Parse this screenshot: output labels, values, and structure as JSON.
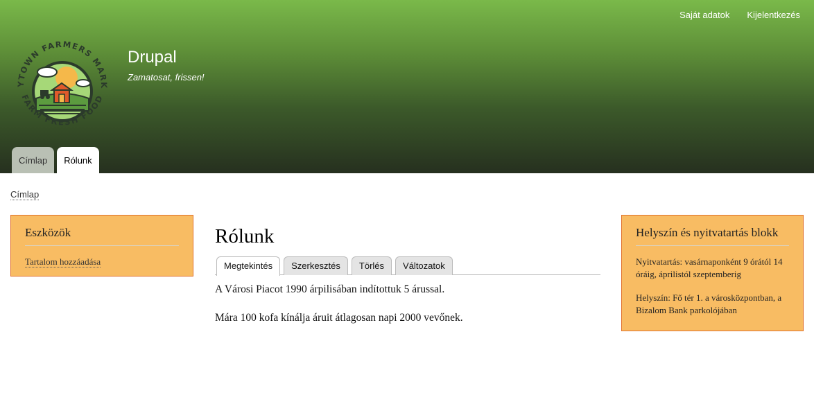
{
  "secondary_menu": {
    "items": [
      "Saját adatok",
      "Kijelentkezés"
    ]
  },
  "logo": {
    "top_text": "ANYTOWN FARMERS MARKET",
    "bottom_text": "FARM FRESH FOOD",
    "colors": {
      "ring": "#2b3a2b",
      "badge": "#8fc964",
      "sun": "#f5b84a",
      "barn": "#e05a2b",
      "field": "#5c9b3f"
    }
  },
  "site": {
    "name": "Drupal",
    "slogan": "Zamatosat, frissen!"
  },
  "primary_tabs": [
    {
      "label": "Címlap",
      "active": false
    },
    {
      "label": "Rólunk",
      "active": true
    }
  ],
  "breadcrumb": {
    "items": [
      "Címlap"
    ]
  },
  "left_block": {
    "title": "Eszközök",
    "links": [
      "Tartalom hozzáadása"
    ]
  },
  "main": {
    "title": "Rólunk",
    "tabs": [
      {
        "label": "Megtekintés",
        "active": true
      },
      {
        "label": "Szerkesztés",
        "active": false
      },
      {
        "label": "Törlés",
        "active": false
      },
      {
        "label": "Változatok",
        "active": false
      }
    ],
    "paragraphs": [
      "A Városi Piacot 1990 árpilisában indítottuk 5 árussal.",
      "Mára 100 kofa kínálja áruit átlagosan napi 2000 vevőnek."
    ]
  },
  "right_block": {
    "title": "Helyszín és nyitvatartás blokk",
    "paragraphs": [
      "Nyitvatartás: vasárnaponként 9 órától 14 óráig, áprilistól szeptemberig",
      "Helyszín: Fő tér 1. a városközpontban, a Bizalom Bank parkolójában"
    ]
  },
  "colors": {
    "header_top": "#7ab94a",
    "header_bottom": "#26301f",
    "block_bg": "#f8bc63",
    "block_border": "#e0702a"
  }
}
